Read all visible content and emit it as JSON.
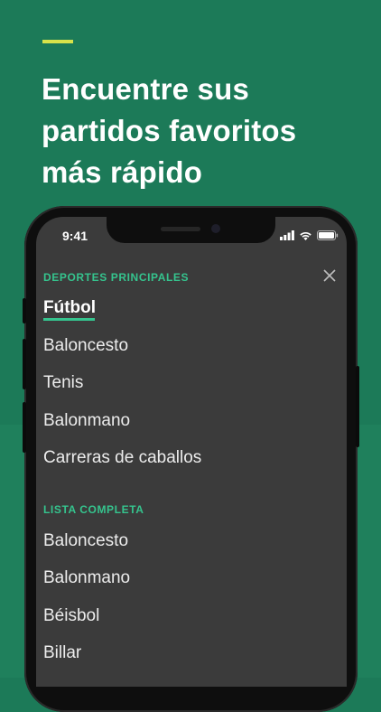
{
  "headline": {
    "line1": "Encuentre sus",
    "line2": "partidos favoritos",
    "line3": "más rápido"
  },
  "status_bar": {
    "time": "9:41",
    "icons": [
      "signal-icon",
      "wifi-icon",
      "battery-icon"
    ]
  },
  "menu": {
    "main_section_title": "DEPORTES PRINCIPALES",
    "main_items": [
      "Fútbol",
      "Baloncesto",
      "Tenis",
      "Balonmano",
      "Carreras de caballos"
    ],
    "selected_item": "Fútbol",
    "full_section_title": "LISTA COMPLETA",
    "full_items": [
      "Baloncesto",
      "Balonmano",
      "Béisbol",
      "Billar"
    ],
    "close_icon": "close-icon"
  },
  "colors": {
    "background": "#1c7a58",
    "accent_yellow": "#d8e24a",
    "accent_green": "#35c48e",
    "screen_bg": "#3b3b3b"
  }
}
